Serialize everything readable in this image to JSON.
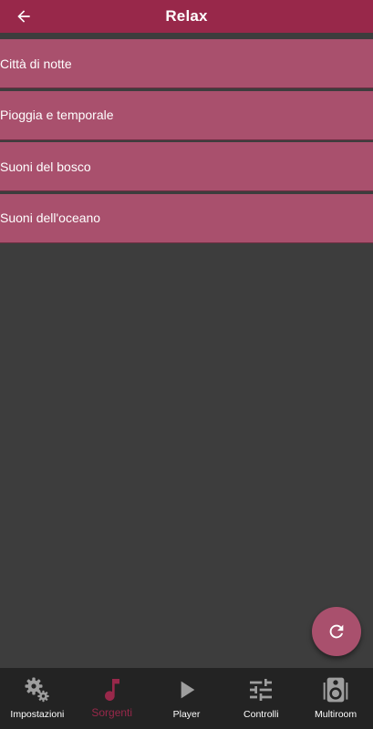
{
  "header": {
    "title": "Relax",
    "back_icon": "arrow-left-icon"
  },
  "list": {
    "items": [
      {
        "label": "Città di notte"
      },
      {
        "label": "Pioggia e temporale"
      },
      {
        "label": "Suoni del bosco"
      },
      {
        "label": "Suoni dell'oceano"
      }
    ]
  },
  "fab": {
    "icon": "refresh-icon"
  },
  "bottom_nav": {
    "active": "Sorgenti",
    "items": [
      {
        "label": "Impostazioni",
        "icon": "gears-icon"
      },
      {
        "label": "Sorgenti",
        "icon": "music-note-icon"
      },
      {
        "label": "Player",
        "icon": "play-icon"
      },
      {
        "label": "Controlli",
        "icon": "sliders-icon"
      },
      {
        "label": "Multiroom",
        "icon": "speaker-icon"
      }
    ]
  },
  "colors": {
    "accent": "#98284a",
    "list_item": "#a9506d",
    "background": "#3d3d3d",
    "nav_background": "#232323"
  }
}
